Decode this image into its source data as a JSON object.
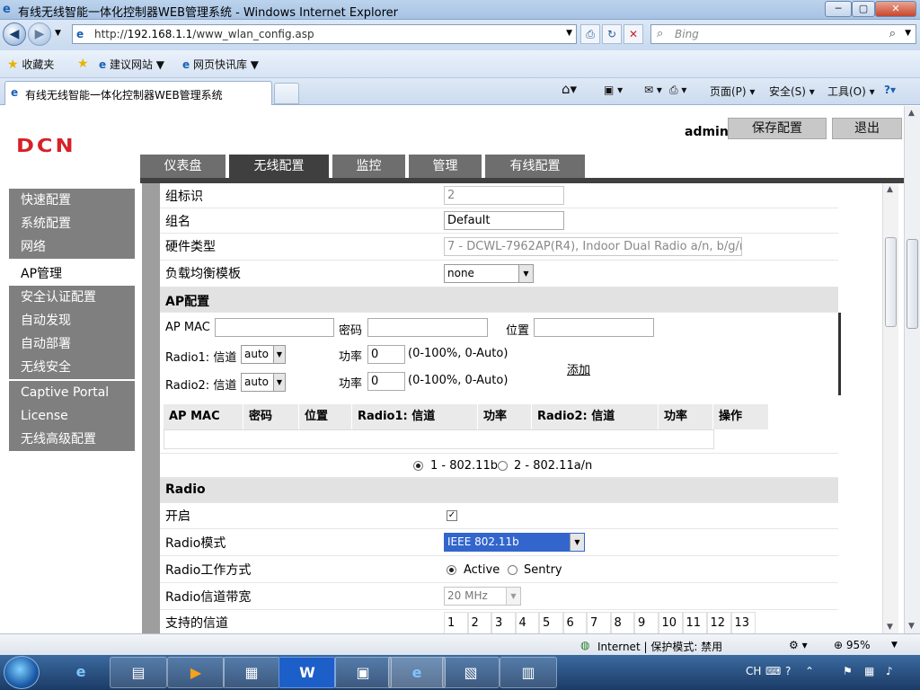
{
  "window": {
    "title": "有线无线智能一体化控制器WEB管理系统 - Windows Internet Explorer",
    "minimize": "─",
    "restore": "▢",
    "close": "✕"
  },
  "address": {
    "url_prefix": "http://",
    "url_host": "192.168.1.1",
    "url_path": "/www_wlan_config.asp",
    "search_placeholder": "Bing"
  },
  "favorites": {
    "favorites_label": "收藏夹",
    "suggested_sites": "建议网站 ▼",
    "web_slice": "网页快讯库 ▼"
  },
  "tabs": {
    "current_tab": "有线无线智能一体化控制器WEB管理系统"
  },
  "toolbar": {
    "page": "页面(P) ▾",
    "safety": "安全(S) ▾",
    "tools": "工具(O) ▾",
    "help": "?▾"
  },
  "header": {
    "logo": "DCN",
    "user": "admin",
    "save_config": "保存配置",
    "logout": "退出"
  },
  "nav_tabs": [
    {
      "label": "仪表盘"
    },
    {
      "label": "无线配置"
    },
    {
      "label": "监控"
    },
    {
      "label": "管理"
    },
    {
      "label": "有线配置"
    }
  ],
  "sidebar": {
    "items": [
      {
        "label": "快速配置"
      },
      {
        "label": "系统配置"
      },
      {
        "label": "网络"
      },
      {
        "label": "AP管理"
      },
      {
        "label": "安全认证配置"
      },
      {
        "label": "自动发现"
      },
      {
        "label": "自动部署"
      },
      {
        "label": "无线安全"
      },
      {
        "label": "Captive Portal"
      },
      {
        "label": "License"
      },
      {
        "label": "无线高级配置"
      }
    ]
  },
  "form": {
    "group_id_label": "组标识",
    "group_id_value": "2",
    "group_name_label": "组名",
    "group_name_value": "Default",
    "hw_type_label": "硬件类型",
    "hw_type_value": "7 - DCWL-7962AP(R4), Indoor Dual Radio a/n, b/g/n",
    "lb_template_label": "负载均衡模板",
    "lb_template_value": "none",
    "ap_config_heading": "AP配置",
    "ap_mac_label": "AP MAC",
    "password_label": "密码",
    "location_label": "位置",
    "radio1_channel_label": "Radio1: 信道",
    "radio1_channel_value": "auto",
    "radio2_channel_label": "Radio2: 信道",
    "radio2_channel_value": "auto",
    "power_label": "功率",
    "power1_value": "0",
    "power2_value": "0",
    "power_hint": "(0-100%, 0-Auto)",
    "add_link": "添加",
    "table_headers": [
      "AP MAC",
      "密码",
      "位置",
      "Radio1: 信道",
      "功率",
      "Radio2: 信道",
      "功率",
      "操作"
    ],
    "radio_option_1": "1 - 802.11b",
    "radio_option_2": "2 - 802.11a/n",
    "radio_selected": 1,
    "radio_heading": "Radio",
    "enable_label": "开启",
    "enable_checked": true,
    "radio_mode_label": "Radio模式",
    "radio_mode_value": "IEEE 802.11b",
    "radio_work_label": "Radio工作方式",
    "work_active": "Active",
    "work_sentry": "Sentry",
    "work_selected": "Active",
    "bandwidth_label": "Radio信道带宽",
    "bandwidth_value": "20 MHz",
    "channels_label": "支持的信道",
    "channels": [
      "1",
      "2",
      "3",
      "4",
      "5",
      "6",
      "7",
      "8",
      "9",
      "10",
      "11",
      "12",
      "13"
    ]
  },
  "status": {
    "zone": "Internet | 保护模式: 禁用",
    "zoom": "95%"
  },
  "tray": {
    "lang": "CH"
  },
  "colors": {
    "nav_active": "#3f3f3f",
    "nav_inactive": "#6e6e6e",
    "sidebar_bg": "#7f7f7f",
    "logo_red": "#d72027",
    "select_highlight": "#3366cc"
  }
}
